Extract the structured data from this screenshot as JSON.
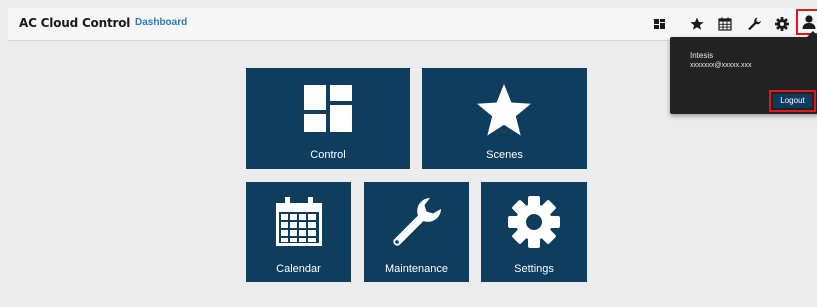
{
  "header": {
    "app_title": "AC Cloud Control",
    "separator": "-",
    "breadcrumb_current": "Dashboard",
    "nav_icons": [
      "dashboard-icon",
      "star-icon",
      "calendar-icon",
      "wrench-icon",
      "gear-icon",
      "user-icon"
    ]
  },
  "user_menu": {
    "user_name": "Intesis",
    "email": "xxxxxxx@xxxxx.xxx",
    "logout_label": "Logout"
  },
  "tiles": [
    {
      "label": "Control",
      "icon": "dashboard-icon"
    },
    {
      "label": "Scenes",
      "icon": "star-icon"
    },
    {
      "label": "Calendar",
      "icon": "calendar-icon"
    },
    {
      "label": "Maintenance",
      "icon": "wrench-icon"
    },
    {
      "label": "Settings",
      "icon": "gear-icon"
    }
  ],
  "colors": {
    "tile_bg": "#0e3d5e",
    "header_bg": "#f6f6f6",
    "page_bg": "#ececec",
    "accent_link": "#2f7ab0",
    "highlight_border": "#e01a1a",
    "popover_bg": "#222222"
  }
}
